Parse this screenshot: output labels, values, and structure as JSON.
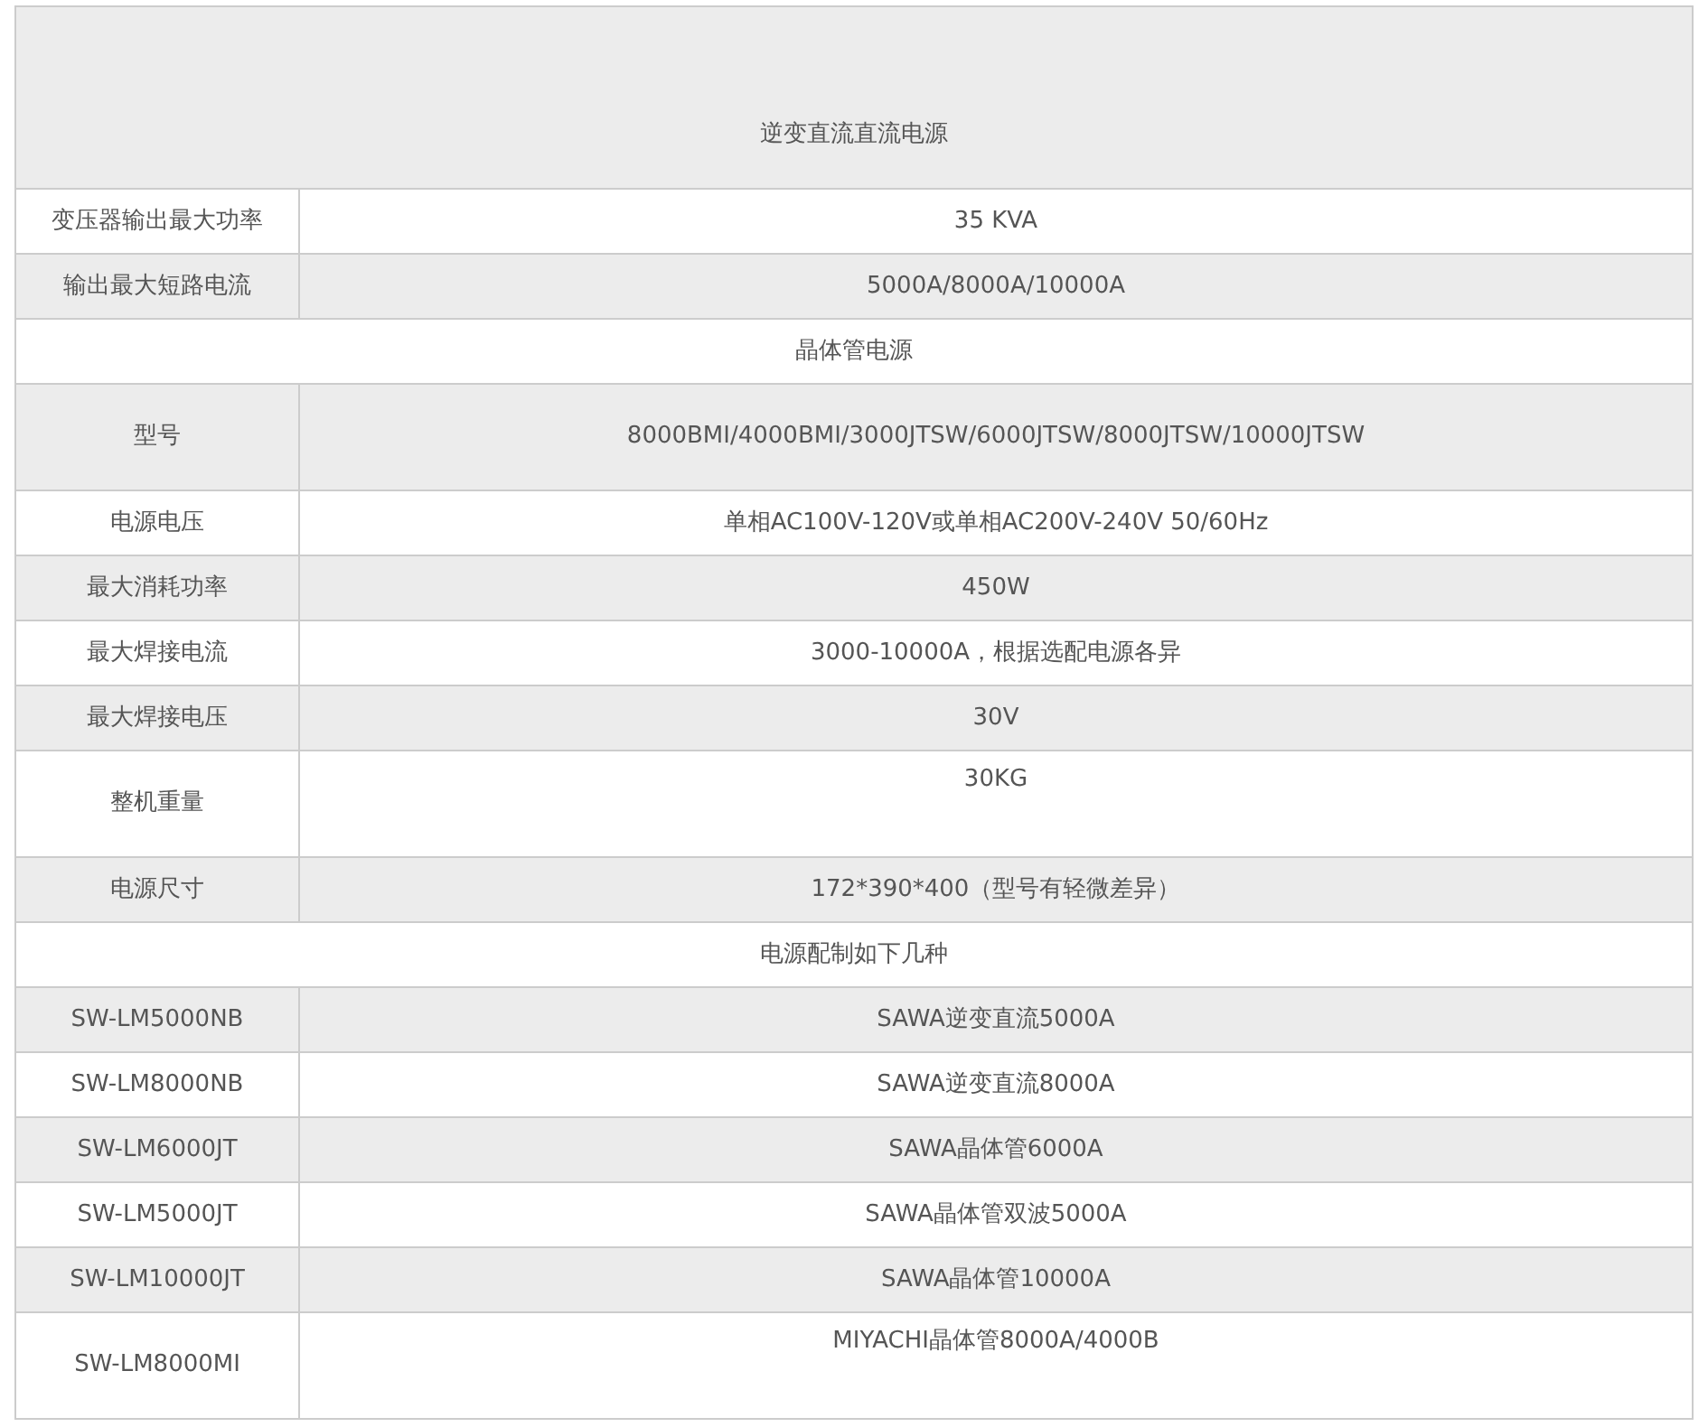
{
  "table": {
    "rows": [
      {
        "kind": "title",
        "shaded": true,
        "text": "逆变直流直流电源"
      },
      {
        "kind": "pair",
        "shaded": false,
        "label": "变压器输出最大功率",
        "value": "35 KVA",
        "value_top": false,
        "tall": false
      },
      {
        "kind": "pair",
        "shaded": true,
        "label": "输出最大短路电流",
        "value": "5000A/8000A/10000A",
        "value_top": false,
        "tall": false
      },
      {
        "kind": "section",
        "shaded": false,
        "text": "晶体管电源"
      },
      {
        "kind": "pair",
        "shaded": true,
        "label": "型号",
        "value": "8000BMI/4000BMI/3000JTSW/6000JTSW/8000JTSW/10000JTSW",
        "value_top": false,
        "tall": true
      },
      {
        "kind": "pair",
        "shaded": false,
        "label": "电源电压",
        "value": "单相AC100V-120V或单相AC200V-240V 50/60Hz",
        "value_top": false,
        "tall": false
      },
      {
        "kind": "pair",
        "shaded": true,
        "label": "最大消耗功率",
        "value": "450W",
        "value_top": false,
        "tall": false
      },
      {
        "kind": "pair",
        "shaded": false,
        "label": "最大焊接电流",
        "value": "3000-10000A，根据选配电源各异",
        "value_top": false,
        "tall": false
      },
      {
        "kind": "pair",
        "shaded": true,
        "label": "最大焊接电压",
        "value": "30V",
        "value_top": false,
        "tall": false
      },
      {
        "kind": "pair",
        "shaded": false,
        "label": "整机重量",
        "value": "30KG",
        "value_top": true,
        "tall": true
      },
      {
        "kind": "pair",
        "shaded": true,
        "label": "电源尺寸",
        "value": "172*390*400（型号有轻微差异）",
        "value_top": false,
        "tall": false
      },
      {
        "kind": "section",
        "shaded": false,
        "text": "电源配制如下几种"
      },
      {
        "kind": "pair",
        "shaded": true,
        "label": "SW-LM5000NB",
        "value": "SAWA逆变直流5000A",
        "value_top": false,
        "tall": false
      },
      {
        "kind": "pair",
        "shaded": false,
        "label": "SW-LM8000NB",
        "value": "SAWA逆变直流8000A",
        "value_top": false,
        "tall": false
      },
      {
        "kind": "pair",
        "shaded": true,
        "label": "SW-LM6000JT",
        "value": "SAWA晶体管6000A",
        "value_top": false,
        "tall": false
      },
      {
        "kind": "pair",
        "shaded": false,
        "label": "SW-LM5000JT",
        "value": "SAWA晶体管双波5000A",
        "value_top": false,
        "tall": false
      },
      {
        "kind": "pair",
        "shaded": true,
        "label": "SW-LM10000JT",
        "value": "SAWA晶体管10000A",
        "value_top": false,
        "tall": false
      },
      {
        "kind": "pair",
        "shaded": false,
        "label": "SW-LM8000MI",
        "value": "MIYACHI晶体管8000A/4000B",
        "value_top": true,
        "tall": true
      }
    ]
  }
}
